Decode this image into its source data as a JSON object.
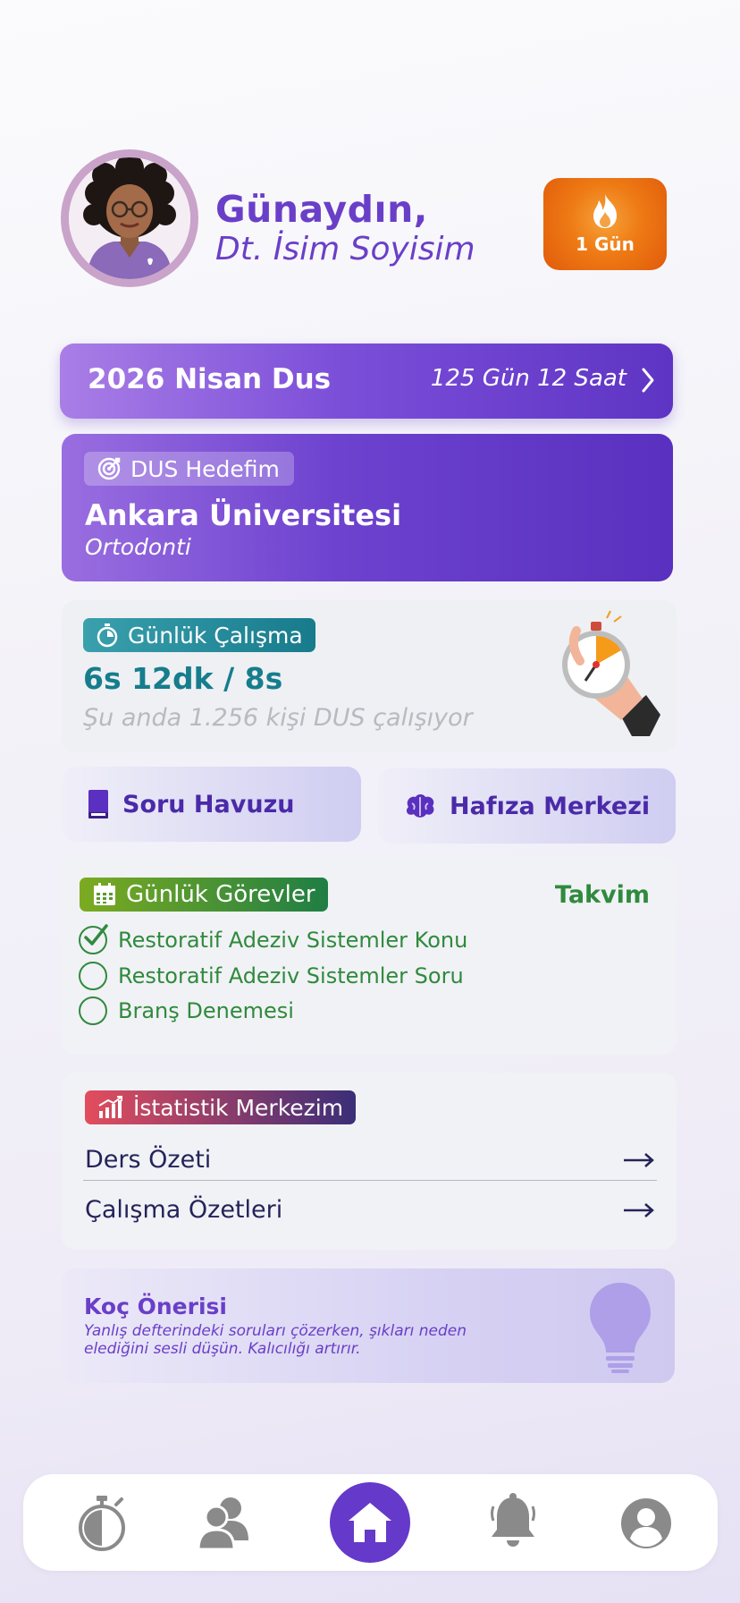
{
  "header": {
    "greeting": "Günaydın,",
    "user_name": "Dt. İsim Soyisim",
    "streak_label": "1 Gün"
  },
  "exam_banner": {
    "title": "2026 Nisan Dus",
    "countdown": "125 Gün 12 Saat"
  },
  "target": {
    "pill_label": "DUS Hedefim",
    "university": "Ankara Üniversitesi",
    "department": "Ortodonti"
  },
  "daily_study": {
    "pill_label": "Günlük Çalışma",
    "time": "6s 12dk / 8s",
    "now_studying": "Şu anda 1.256 kişi DUS çalışıyor"
  },
  "quick_actions": {
    "question_pool": "Soru Havuzu",
    "memory_center": "Hafıza Merkezi"
  },
  "tasks": {
    "pill_label": "Günlük Görevler",
    "calendar_link": "Takvim",
    "items": [
      {
        "label": "Restoratif Adeziv Sistemler Konu",
        "done": true
      },
      {
        "label": "Restoratif Adeziv Sistemler Soru",
        "done": false
      },
      {
        "label": "Branş Denemesi",
        "done": false
      }
    ]
  },
  "stats": {
    "pill_label": "İstatistik Merkezim",
    "rows": [
      "Ders Özeti",
      "Çalışma Özetleri"
    ]
  },
  "coach": {
    "title": "Koç Önerisi",
    "text": "Yanlış defterindeki soruları çözerken, şıkları neden elediğini sesli düşün. Kalıcılığı artırır."
  },
  "nav": {
    "items": [
      "stopwatch-icon",
      "users-icon",
      "home-icon",
      "bell-icon",
      "profile-icon"
    ],
    "active": "home-icon"
  },
  "colors": {
    "primary": "#6a3fc8",
    "teal": "#167d8c",
    "green": "#2f8a3d",
    "streak_orange": "#ee7a14",
    "navy": "#24235a"
  }
}
